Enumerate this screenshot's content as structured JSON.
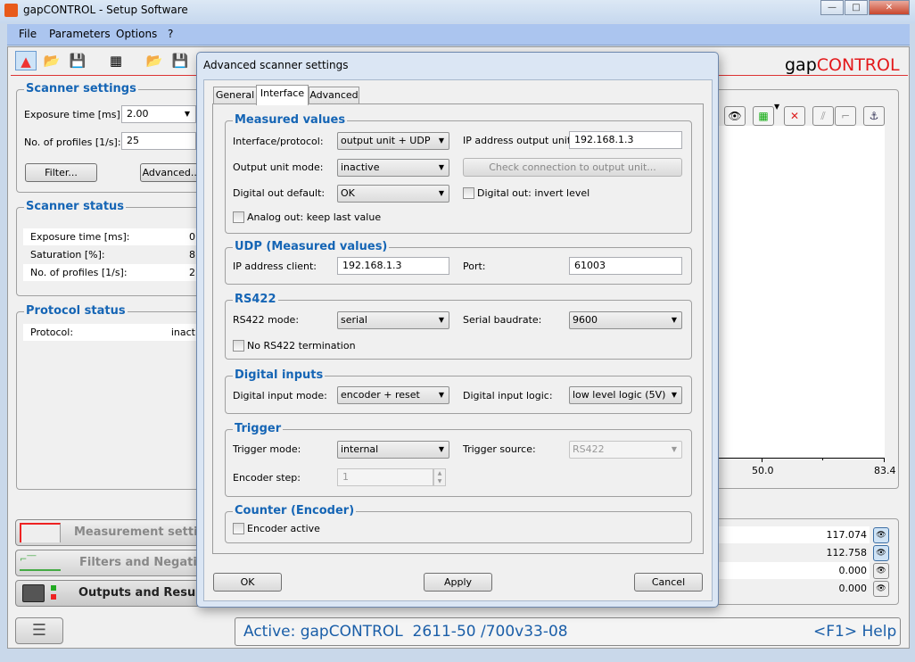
{
  "window": {
    "title": "gapCONTROL - Setup Software",
    "min": "—",
    "max": "□",
    "close": "✕"
  },
  "menu": [
    "File",
    "Parameters",
    "Options",
    "?"
  ],
  "logo": {
    "gap": "gap",
    "control": "CONTROL"
  },
  "scanner_settings": {
    "title": "Scanner settings",
    "exposure_label": "Exposure time [ms]:",
    "exposure_value": "2.00",
    "profiles_label": "No. of profiles [1/s]:",
    "profiles_value": "25",
    "filter_btn": "Filter...",
    "advanced_btn": "Advanced..."
  },
  "scanner_status": {
    "title": "Scanner status",
    "rows": [
      {
        "label": "Exposure time [ms]:",
        "value": "0"
      },
      {
        "label": "Saturation [%]:",
        "value": "8"
      },
      {
        "label": "No. of profiles [1/s]:",
        "value": "2"
      }
    ]
  },
  "protocol_status": {
    "title": "Protocol status",
    "label": "Protocol:",
    "value": "inact"
  },
  "chart": {
    "ticks": [
      "50.0",
      "83.4"
    ]
  },
  "results": [
    "117.074",
    "112.758",
    "0.000",
    "0.000"
  ],
  "nav": {
    "measurement": "Measurement setting",
    "filters": "Filters and Negatio",
    "outputs": "Outputs and Results"
  },
  "status": {
    "active": "Active: gapCONTROL  2611-50 /700v33-08",
    "help": "<F1> Help"
  },
  "dialog": {
    "title": "Advanced scanner settings",
    "tabs": [
      "General",
      "Interface",
      "Advanced"
    ],
    "measured": {
      "title": "Measured values",
      "iface_label": "Interface/protocol:",
      "iface_value": "output unit + UDP",
      "ip_label": "IP address output unit:",
      "ip_value": "192.168.1.3",
      "mode_label": "Output unit mode:",
      "mode_value": "inactive",
      "check_btn": "Check connection to output unit...",
      "dout_label": "Digital out default:",
      "dout_value": "OK",
      "invert_label": "Digital out: invert level",
      "analog_label": "Analog out: keep last value"
    },
    "udp": {
      "title": "UDP (Measured values)",
      "ip_label": "IP address client:",
      "ip_value": "192.168.1.3",
      "port_label": "Port:",
      "port_value": "61003"
    },
    "rs422": {
      "title": "RS422",
      "mode_label": "RS422 mode:",
      "mode_value": "serial",
      "baud_label": "Serial baudrate:",
      "baud_value": "9600",
      "term_label": "No RS422 termination"
    },
    "dinputs": {
      "title": "Digital inputs",
      "mode_label": "Digital input mode:",
      "mode_value": "encoder + reset",
      "logic_label": "Digital input logic:",
      "logic_value": "low level logic (5V)"
    },
    "trigger": {
      "title": "Trigger",
      "mode_label": "Trigger mode:",
      "mode_value": "internal",
      "source_label": "Trigger source:",
      "source_value": "RS422",
      "step_label": "Encoder step:",
      "step_value": "1"
    },
    "counter": {
      "title": "Counter (Encoder)",
      "active_label": "Encoder active"
    },
    "ok": "OK",
    "apply": "Apply",
    "cancel": "Cancel"
  }
}
